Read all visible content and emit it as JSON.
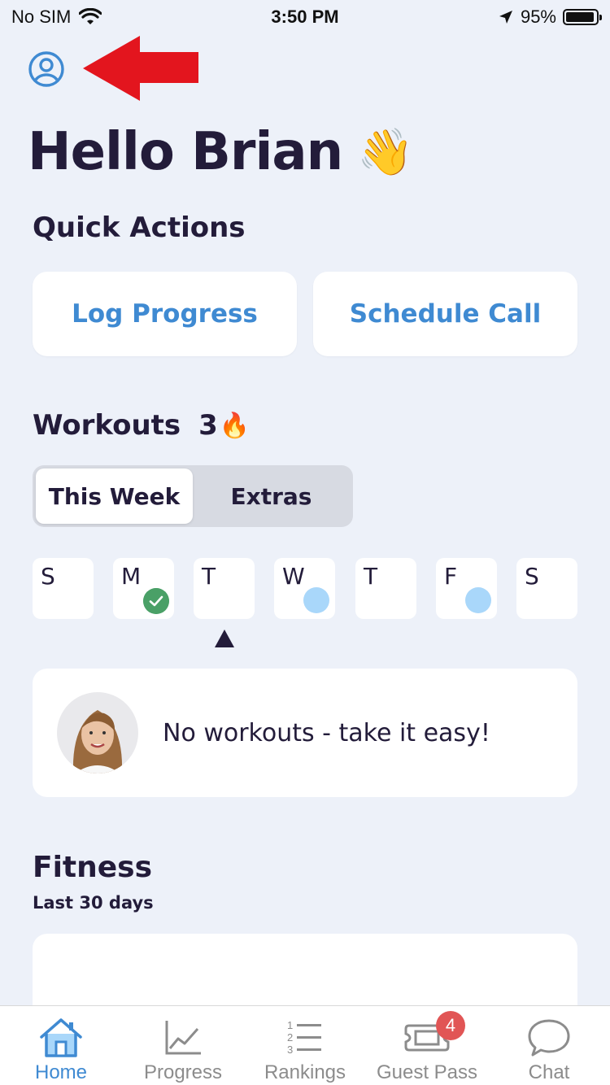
{
  "status_bar": {
    "carrier": "No SIM",
    "time": "3:50 PM",
    "battery": "95%",
    "battery_level": 0.95,
    "icons": [
      "wifi-icon",
      "location-arrow-icon",
      "battery-icon"
    ]
  },
  "header": {
    "profile_icon": "user-circle-icon",
    "annotation": "red-arrow-pointing-left",
    "greeting": "Hello Brian",
    "greeting_emoji": "👋"
  },
  "quick_actions": {
    "title": "Quick Actions",
    "buttons": [
      "Log Progress",
      "Schedule Call"
    ]
  },
  "workouts": {
    "title": "Workouts",
    "streak_count": "3",
    "streak_emoji": "🔥",
    "tabs": [
      {
        "label": "This Week",
        "active": true
      },
      {
        "label": "Extras",
        "active": false
      }
    ],
    "days": [
      {
        "letter": "S",
        "status": "none"
      },
      {
        "letter": "M",
        "status": "completed"
      },
      {
        "letter": "T",
        "status": "none",
        "selected": true
      },
      {
        "letter": "W",
        "status": "scheduled"
      },
      {
        "letter": "T",
        "status": "none"
      },
      {
        "letter": "F",
        "status": "scheduled"
      },
      {
        "letter": "S",
        "status": "none"
      }
    ],
    "message": "No workouts - take it easy!"
  },
  "fitness": {
    "title": "Fitness",
    "subtitle": "Last 30 days"
  },
  "tab_bar": {
    "items": [
      {
        "label": "Home",
        "icon": "home-icon",
        "active": true
      },
      {
        "label": "Progress",
        "icon": "chart-line-icon",
        "active": false
      },
      {
        "label": "Rankings",
        "icon": "numbered-list-icon",
        "active": false
      },
      {
        "label": "Guest Pass",
        "icon": "ticket-icon",
        "active": false,
        "badge": "4"
      },
      {
        "label": "Chat",
        "icon": "chat-bubble-icon",
        "active": false
      }
    ]
  },
  "colors": {
    "background": "#edf1f9",
    "accent": "#3f8ad2",
    "text_dark": "#231c3a",
    "completed_green": "#4aa067",
    "scheduled_blue": "#a9d7fa",
    "badge_red": "#e15555",
    "annotation_red": "#e3151e"
  }
}
